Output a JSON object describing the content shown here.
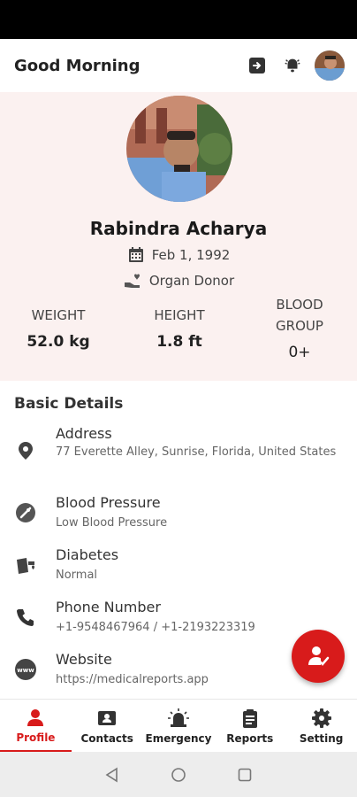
{
  "header": {
    "greeting": "Good Morning",
    "icons": [
      "logout-icon",
      "bell-icon",
      "avatar"
    ]
  },
  "profile": {
    "name": "Rabindra Acharya",
    "dob": "Feb 1, 1992",
    "donor_status": "Organ Donor",
    "stats": {
      "weight_label": "WEIGHT",
      "weight_value": "52.0 kg",
      "height_label": "HEIGHT",
      "height_value": "1.8 ft",
      "blood_label_1": "BLOOD",
      "blood_label_2": "GROUP",
      "blood_value": "0+"
    }
  },
  "details": {
    "title": "Basic Details",
    "address_label": "Address",
    "address_value": "77 Everette Alley, Sunrise, Florida, United States",
    "bp_label": "Blood Pressure",
    "bp_value": "Low Blood Pressure",
    "diabetes_label": "Diabetes",
    "diabetes_value": "Normal",
    "phone_label": "Phone Number",
    "phone_value": "+1-9548467964 / +1-2193223319",
    "website_label": "Website",
    "website_value": "https://medicalreports.app"
  },
  "nav": {
    "items": [
      {
        "label": "Profile",
        "icon": "person-icon",
        "active": true
      },
      {
        "label": "Contacts",
        "icon": "contact-card-icon",
        "active": false
      },
      {
        "label": "Emergency",
        "icon": "siren-icon",
        "active": false
      },
      {
        "label": "Reports",
        "icon": "clipboard-icon",
        "active": false
      },
      {
        "label": "Setting",
        "icon": "gear-icon",
        "active": false
      }
    ]
  },
  "colors": {
    "accent": "#d81b1b",
    "card_bg": "#fbf1f0"
  }
}
